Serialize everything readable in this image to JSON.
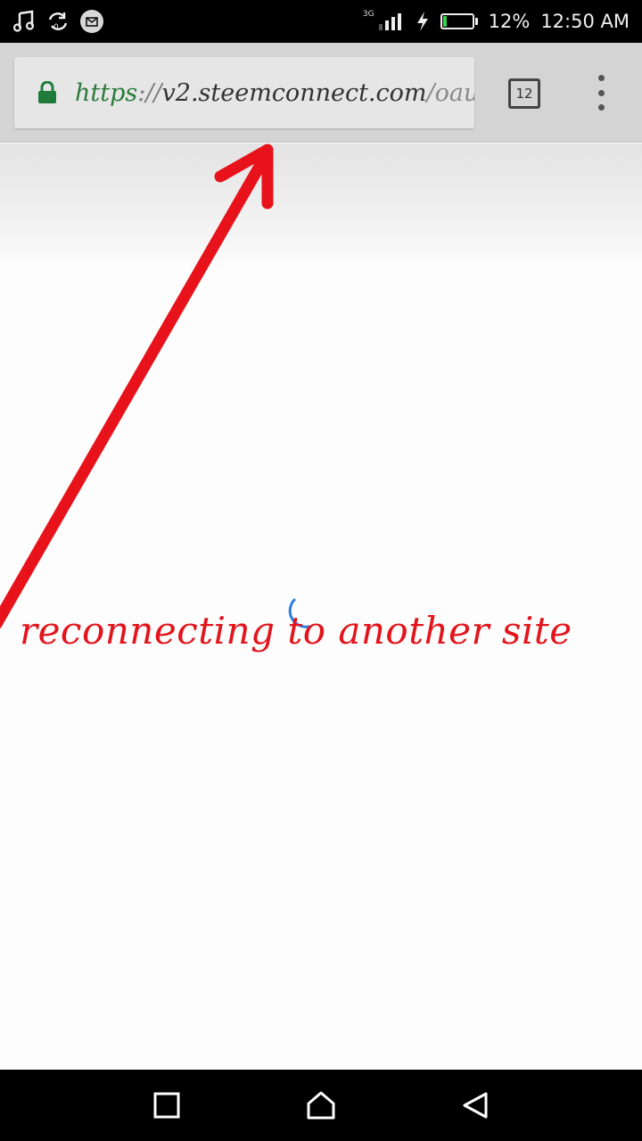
{
  "status_bar": {
    "network_label": "3G",
    "battery_percent": 12,
    "battery_text": "12%",
    "time": "12:50 AM",
    "icons": [
      "music-icon",
      "sync-icon",
      "mail-icon",
      "signal-icon",
      "charging-icon",
      "battery-icon"
    ]
  },
  "browser": {
    "url": {
      "scheme": "https",
      "separator": "://",
      "host": "v2.steemconnect.com",
      "path": "/oau"
    },
    "tab_count": "12"
  },
  "annotation": {
    "text": "reconnecting to another site",
    "color": "#e3141c"
  },
  "colors": {
    "secure_green": "#1e7b3a",
    "spinner_blue": "#2a7fe0",
    "battery_green": "#35d24a"
  }
}
